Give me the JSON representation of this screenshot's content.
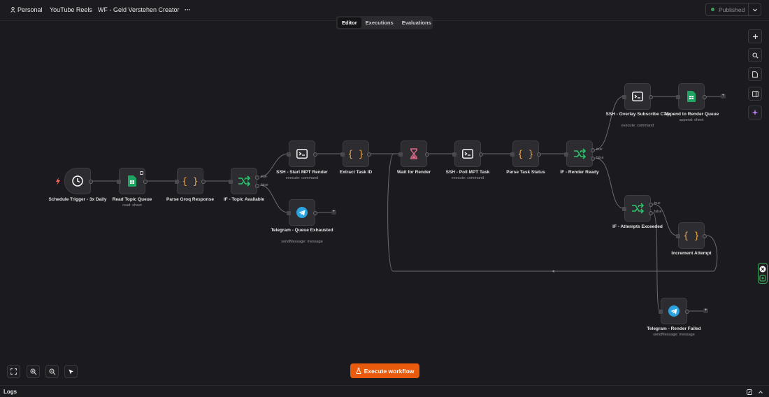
{
  "header": {
    "project": "Personal",
    "folder": "YouTube Reels",
    "workflow_name": "WF - Geld Verstehen Creator",
    "more": "···",
    "publish_label": "Published",
    "publish_status_color": "#3f9b5a"
  },
  "tabs": [
    {
      "label": "Editor",
      "active": true
    },
    {
      "label": "Executions",
      "active": false
    },
    {
      "label": "Evaluations",
      "active": false
    }
  ],
  "nodes": {
    "schedule_trigger": {
      "label": "Schedule Trigger - 3x Daily",
      "icon": "clock-icon"
    },
    "read_topic_queue": {
      "label": "Read Topic Queue",
      "sub": "read: sheet",
      "icon": "google-sheets-icon"
    },
    "parse_groq": {
      "label": "Parse Groq Response",
      "icon": "code-braces-icon"
    },
    "if_topic": {
      "label": "IF - Topic Available",
      "icon": "if-branch-icon",
      "true_label": "true",
      "false_label": "false"
    },
    "telegram_queue": {
      "label": "Telegram - Queue Exhausted",
      "sub": "sendMessage: message",
      "icon": "telegram-icon"
    },
    "ssh_start": {
      "label": "SSH - Start MPT Render",
      "sub": "execute: command",
      "icon": "terminal-icon"
    },
    "extract_task": {
      "label": "Extract Task ID",
      "icon": "code-braces-icon"
    },
    "wait_render": {
      "label": "Wait for Render",
      "icon": "hourglass-icon"
    },
    "ssh_poll": {
      "label": "SSH - Poll MPT Task",
      "sub": "execute: command",
      "icon": "terminal-icon"
    },
    "parse_status": {
      "label": "Parse Task Status",
      "icon": "code-braces-icon"
    },
    "if_render": {
      "label": "IF - Render Ready",
      "icon": "if-branch-icon",
      "true_label": "true",
      "false_label": "false"
    },
    "ssh_overlay": {
      "label": "SSH - Overlay Subscribe CTA",
      "sub": "execute: command",
      "icon": "terminal-icon"
    },
    "append_queue": {
      "label": "Append to Render Queue",
      "sub": "append: sheet",
      "icon": "google-sheets-icon"
    },
    "if_attempts": {
      "label": "IF - Attempts Exceeded",
      "icon": "if-branch-icon",
      "true_label": "true",
      "false_label": "false"
    },
    "increment": {
      "label": "Increment Attempt",
      "icon": "code-braces-icon"
    },
    "telegram_failed": {
      "label": "Telegram - Render Failed",
      "sub": "sendMessage: message",
      "icon": "telegram-icon"
    }
  },
  "plus_sign": "+",
  "execute_button": "Execute workflow",
  "logs_label": "Logs",
  "colors": {
    "accent": "#ea5a0c",
    "sheets": "#1fa463",
    "if_node": "#2bc46a",
    "code": "#e8a24a",
    "wait": "#e06c8c",
    "telegram": "#2aa3e0"
  }
}
